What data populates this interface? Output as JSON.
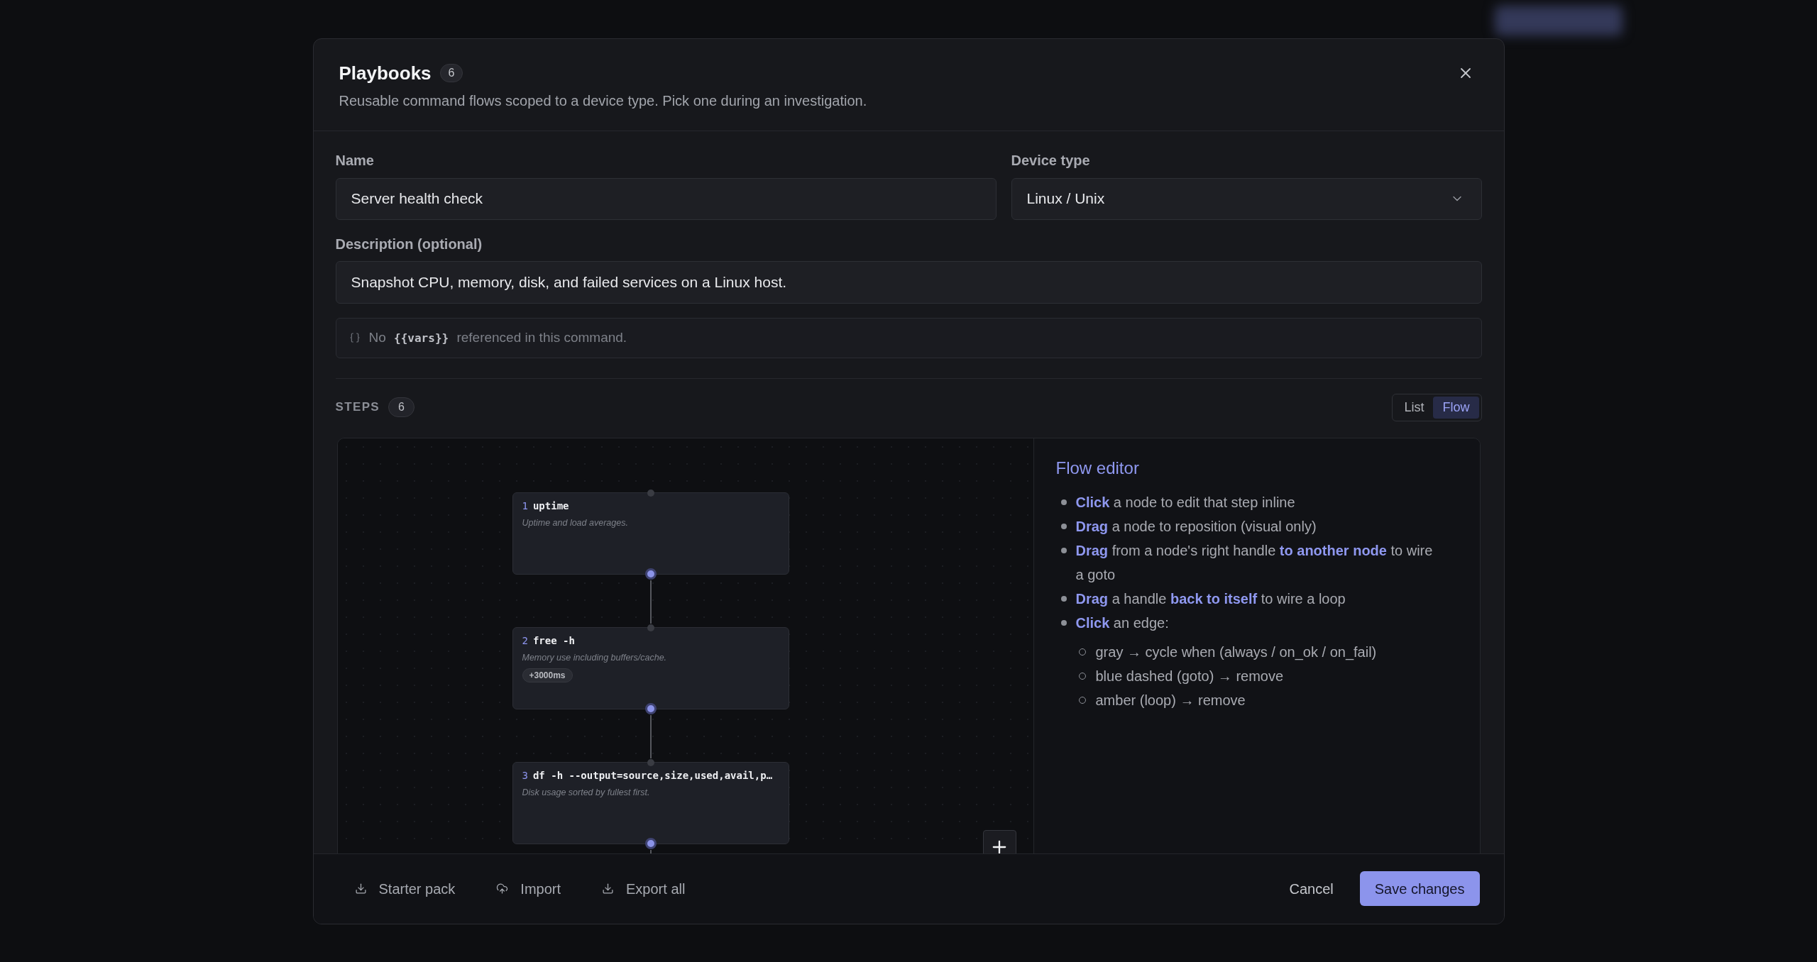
{
  "dialog": {
    "title": "Playbooks",
    "count": "6",
    "subtitle": "Reusable command flows scoped to a device type. Pick one during an investigation."
  },
  "form": {
    "name": {
      "label": "Name",
      "value": "Server health check"
    },
    "device_type": {
      "label": "Device type",
      "value": "Linux / Unix"
    },
    "description": {
      "label": "Description (optional)",
      "value": "Snapshot CPU, memory, disk, and failed services on a Linux host."
    },
    "vars_note": {
      "before": "No",
      "code": "{{vars}}",
      "after": "referenced in this command."
    }
  },
  "steps": {
    "label": "STEPS",
    "count": "6",
    "view_toggle": [
      {
        "label": "List",
        "selected": false
      },
      {
        "label": "Flow",
        "selected": true
      }
    ]
  },
  "flow": {
    "nodes": [
      {
        "number": "1",
        "command": "uptime",
        "description": "Uptime and load averages."
      },
      {
        "number": "2",
        "command": "free -h",
        "description": "Memory use including buffers/cache.",
        "delay": "+3000ms"
      },
      {
        "number": "3",
        "command": "df -h --output=source,size,used,avail,p…",
        "description": "Disk usage sorted by fullest first."
      }
    ]
  },
  "help": {
    "title": "Flow editor",
    "items": [
      {
        "text": "**Click** a node to edit that step inline"
      },
      {
        "text": "**Drag** a node to reposition (visual only)"
      },
      {
        "text": "**Drag** from a node's right handle **to another node** to wire a goto"
      },
      {
        "text": "**Drag** a handle **back to itself** to wire a loop"
      },
      {
        "text": "**Click** an edge:",
        "children": [
          {
            "text": "gray → cycle when (always / on_ok / on_fail)"
          },
          {
            "text": "blue dashed (goto) → remove"
          },
          {
            "text": "amber (loop) → remove"
          }
        ]
      }
    ]
  },
  "footer": {
    "actions": [
      {
        "label": "Starter pack",
        "kind": "download"
      },
      {
        "label": "Import",
        "kind": "upload"
      },
      {
        "label": "Export all",
        "kind": "download"
      }
    ],
    "cancel": "Cancel",
    "save": "Save changes"
  }
}
